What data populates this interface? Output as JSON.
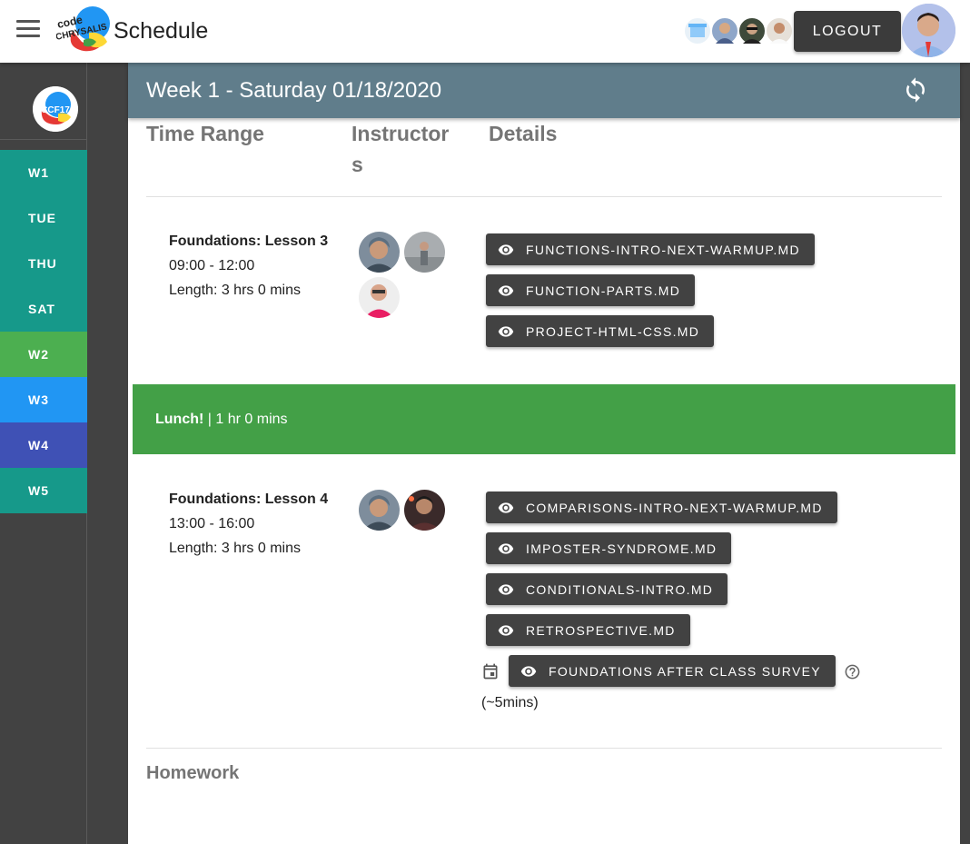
{
  "header": {
    "title": "Schedule",
    "logout_label": "LOGOUT",
    "logo_alt": "Code Chrysalis"
  },
  "sidebar": {
    "logo_text": "CCF17",
    "items": [
      {
        "label": "W1",
        "color": "#16998a"
      },
      {
        "label": "TUE",
        "color": "#16998a"
      },
      {
        "label": "THU",
        "color": "#16998a"
      },
      {
        "label": "SAT",
        "color": "#16998a"
      },
      {
        "label": "W2",
        "color": "#4caf50"
      },
      {
        "label": "W3",
        "color": "#2196f3"
      },
      {
        "label": "W4",
        "color": "#3f51b5"
      },
      {
        "label": "W5",
        "color": "#16998a"
      }
    ]
  },
  "card": {
    "title": "Week 1 - Saturday 01/18/2020",
    "columns": {
      "time_range": "Time Range",
      "instructors_1": "Instructor",
      "instructors_2": "s",
      "details": "Details"
    },
    "lessons": [
      {
        "title": "Foundations: Lesson 3",
        "time": "09:00 - 12:00",
        "length": "Length: 3 hrs 0 mins",
        "materials": [
          "FUNCTIONS-INTRO-NEXT-WARMUP.MD",
          "FUNCTION-PARTS.MD",
          "PROJECT-HTML-CSS.MD"
        ]
      },
      {
        "title": "Foundations: Lesson 4",
        "time": "13:00 - 16:00",
        "length": "Length: 3 hrs 0 mins",
        "materials": [
          "COMPARISONS-INTRO-NEXT-WARMUP.MD",
          "IMPOSTER-SYNDROME.MD",
          "CONDITIONALS-INTRO.MD",
          "RETROSPECTIVE.MD"
        ],
        "survey": "FOUNDATIONS AFTER CLASS SURVEY",
        "survey_note": "(~5mins)"
      }
    ],
    "lunch": {
      "label": "Lunch!",
      "duration": " | 1 hr 0 mins"
    },
    "homework_label": "Homework"
  },
  "colors": {
    "header": "#607d8b",
    "lunch": "#43a047",
    "chip": "#424242"
  }
}
